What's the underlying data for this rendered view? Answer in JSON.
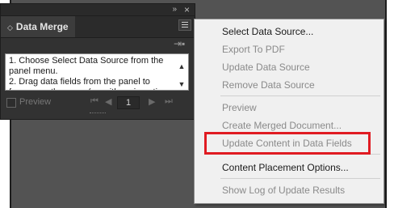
{
  "panel": {
    "title": "Data Merge",
    "collapse_icon": "double-chevron-right",
    "close_icon": "close-x",
    "instructions": "1. Choose Select Data Source from the panel menu.\n2. Drag data fields from the panel to frames on the page (or, with an insertion point",
    "preview_label": "Preview",
    "page_number": "1"
  },
  "menu": {
    "items": [
      {
        "label": "Select Data Source...",
        "enabled": true
      },
      {
        "label": "Export To PDF",
        "enabled": false
      },
      {
        "label": "Update Data Source",
        "enabled": false
      },
      {
        "label": "Remove Data Source",
        "enabled": false
      },
      {
        "label": "Preview",
        "enabled": false
      },
      {
        "label": "Create Merged Document...",
        "enabled": false
      },
      {
        "label": "Update Content in Data Fields",
        "enabled": false
      },
      {
        "label": "Content Placement Options...",
        "enabled": true
      },
      {
        "label": "Show Log of Update Results",
        "enabled": false
      }
    ],
    "highlighted_item": "Update Content in Data Fields"
  },
  "colors": {
    "highlight": "#e01b22",
    "panel_bg": "#323232",
    "menu_bg": "#f0f0f0"
  }
}
